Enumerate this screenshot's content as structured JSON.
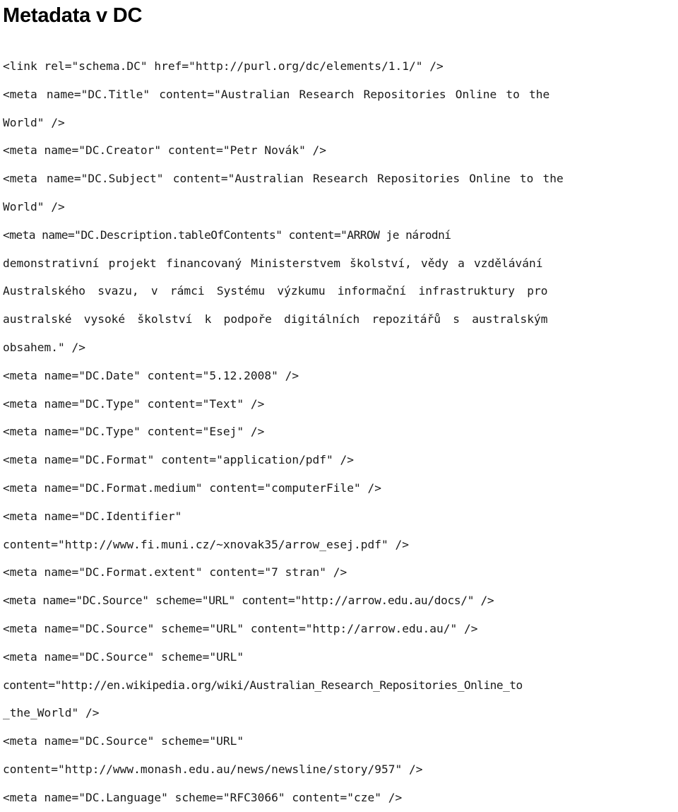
{
  "document": {
    "title": "Metadata v DC",
    "language_of_content": "cs",
    "background_color": "#ffffff",
    "text_color": "#1a1a1a"
  },
  "code": {
    "lines": [
      {
        "id": "link-schema",
        "text": "<link rel=\"schema.DC\" href=\"http://purl.org/dc/elements/1.1/\" />",
        "style": "normal"
      },
      {
        "id": "dc-title-1",
        "text": "<meta name=\"DC.Title\" content=\"Australian Research Repositories Online to the",
        "style": "justified"
      },
      {
        "id": "dc-title-2",
        "text": "World\" />",
        "style": "normal"
      },
      {
        "id": "dc-creator",
        "text": "<meta name=\"DC.Creator\" content=\"Petr Novák\" />",
        "style": "normal"
      },
      {
        "id": "dc-subject-1",
        "text": "<meta name=\"DC.Subject\" content=\"Australian Research Repositories Online to the",
        "style": "justified"
      },
      {
        "id": "dc-subject-2",
        "text": "World\" />",
        "style": "normal"
      },
      {
        "id": "dc-description-toc-1",
        "text": "<meta name=\"DC.Description.tableOfContents\" content=\"ARROW je národní",
        "style": "tight"
      },
      {
        "id": "dc-description-toc-2",
        "text": "demonstrativní projekt financovaný Ministerstvem školství, vědy a vzdělávání",
        "style": "justified"
      },
      {
        "id": "dc-description-toc-3",
        "text": "Australského svazu, v rámci Systému výzkumu informační infrastruktury pro",
        "style": "justified-wide"
      },
      {
        "id": "dc-description-toc-4",
        "text": "australské vysoké školství k podpoře digitálních repozitářů s australským",
        "style": "justified-wide"
      },
      {
        "id": "dc-description-toc-5",
        "text": "obsahem.\" />",
        "style": "normal"
      },
      {
        "id": "dc-date",
        "text": "<meta name=\"DC.Date\" content=\"5.12.2008\" />",
        "style": "normal"
      },
      {
        "id": "dc-type-text",
        "text": "<meta name=\"DC.Type\" content=\"Text\" />",
        "style": "normal"
      },
      {
        "id": "dc-type-esej",
        "text": "<meta name=\"DC.Type\" content=\"Esej\" />",
        "style": "normal"
      },
      {
        "id": "dc-format",
        "text": "<meta name=\"DC.Format\" content=\"application/pdf\" />",
        "style": "normal"
      },
      {
        "id": "dc-format-medium",
        "text": "<meta name=\"DC.Format.medium\" content=\"computerFile\" />",
        "style": "normal"
      },
      {
        "id": "dc-identifier-1",
        "text": "<meta name=\"DC.Identifier\"",
        "style": "normal"
      },
      {
        "id": "dc-identifier-2",
        "text": "content=\"http://www.fi.muni.cz/~xnovak35/arrow_esej.pdf\" />",
        "style": "normal"
      },
      {
        "id": "dc-format-extent",
        "text": "<meta name=\"DC.Format.extent\" content=\"7 stran\" />",
        "style": "normal"
      },
      {
        "id": "dc-source-docs",
        "text": "<meta name=\"DC.Source\" scheme=\"URL\" content=\"http://arrow.edu.au/docs/\" />",
        "style": "tight2"
      },
      {
        "id": "dc-source-root",
        "text": "<meta name=\"DC.Source\" scheme=\"URL\" content=\"http://arrow.edu.au/\" />",
        "style": "normal"
      },
      {
        "id": "dc-source-wikipedia-1",
        "text": "<meta name=\"DC.Source\" scheme=\"URL\"",
        "style": "normal"
      },
      {
        "id": "dc-source-wikipedia-2",
        "text": "content=\"http://en.wikipedia.org/wiki/Australian_Research_Repositories_Online_to",
        "style": "tight"
      },
      {
        "id": "dc-source-wikipedia-3",
        "text": "_the_World\" />",
        "style": "normal"
      },
      {
        "id": "dc-source-monash-1",
        "text": "<meta name=\"DC.Source\" scheme=\"URL\"",
        "style": "normal"
      },
      {
        "id": "dc-source-monash-2",
        "text": "content=\"http://www.monash.edu.au/news/newsline/story/957\" />",
        "style": "normal"
      },
      {
        "id": "dc-language",
        "text": "<meta name=\"DC.Language\" scheme=\"RFC3066\" content=\"cze\" />",
        "style": "normal"
      }
    ]
  }
}
